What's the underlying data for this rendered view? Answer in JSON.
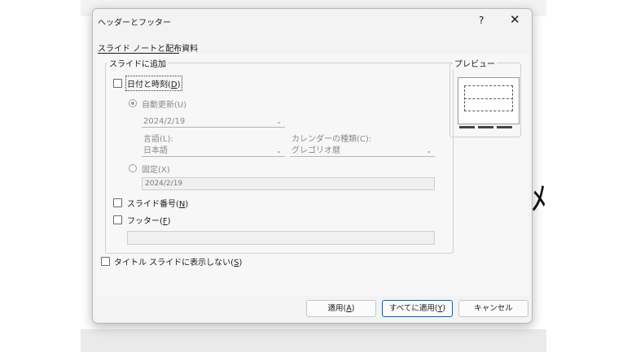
{
  "background": {
    "glyph": "ﾒ"
  },
  "dialog": {
    "title": "ヘッダーとフッター",
    "help_label": "?",
    "close_label": "✕",
    "tab_label": "スライド ノートと配布資料"
  },
  "include_group": {
    "legend": "スライドに追加",
    "date_time": {
      "label": "日付と時刻(",
      "accel": "D",
      "close": ")",
      "checked": false
    },
    "auto_update": {
      "label": "自動更新(U)",
      "selected": true
    },
    "date_value": "2024/2/19",
    "language_label": "言語(L):",
    "language_value": "日本語",
    "calendar_label": "カレンダーの種類(C):",
    "calendar_value": "グレゴリオ暦",
    "fixed": {
      "label": "固定(X)",
      "selected": false
    },
    "fixed_value": "2024/2/19",
    "slide_number": {
      "label": "スライド番号(",
      "accel": "N",
      "close": ")",
      "checked": false
    },
    "footer": {
      "label": "フッター(",
      "accel": "F",
      "close": ")",
      "checked": false
    },
    "footer_text": ""
  },
  "dont_show_title": {
    "label": "タイトル スライドに表示しない(",
    "accel": "S",
    "close": ")",
    "checked": false
  },
  "preview": {
    "legend": "プレビュー"
  },
  "buttons": {
    "apply": {
      "label": "適用(",
      "accel": "A",
      "close": ")"
    },
    "apply_all": {
      "label": "すべてに適用(",
      "accel": "Y",
      "close": ")"
    },
    "cancel": "キャンセル"
  },
  "dropdown_chevron": "⌄",
  "colors": {
    "accent": "#0060c0",
    "disabled_text": "#8a8a8a",
    "dialog_bg": "#f3f3f3"
  }
}
